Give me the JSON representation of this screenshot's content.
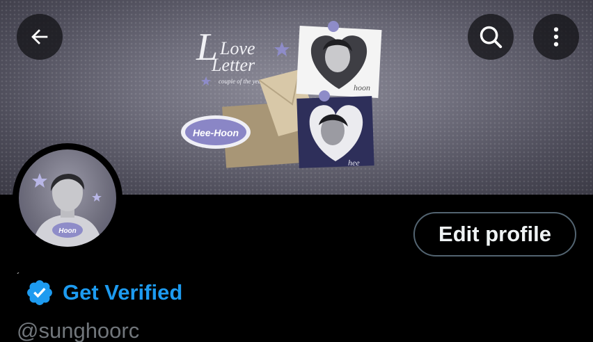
{
  "header": {
    "back_icon": "arrow-left-icon",
    "search_icon": "search-icon",
    "more_icon": "more-vertical-icon"
  },
  "banner": {
    "title_line1": "Love",
    "title_line2": "Letter",
    "subtitle": "couple of the year",
    "sticker_label": "Hee-Hoon",
    "photo_top_caption": "hoon",
    "photo_bottom_caption": "hee"
  },
  "avatar": {
    "badge_text": "Hoon"
  },
  "profile": {
    "edit_label": "Edit profile",
    "name_mark": "´",
    "verified_label": "Get Verified",
    "handle": "@sunghoorc"
  },
  "colors": {
    "background": "#000000",
    "accent": "#1d9bf0",
    "handle": "#71767b",
    "button_border": "#536471"
  }
}
